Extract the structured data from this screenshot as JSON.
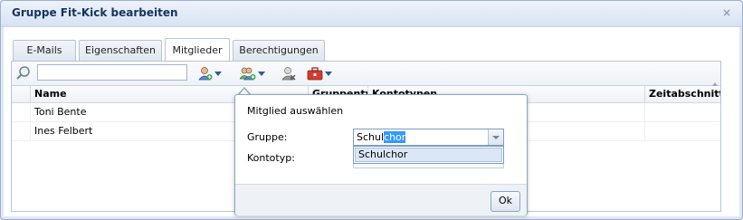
{
  "window": {
    "title": "Gruppe Fit-Kick bearbeiten",
    "close_glyph": "×"
  },
  "tabs": [
    {
      "label": "E-Mails",
      "active": false
    },
    {
      "label": "Eigenschaften",
      "active": false
    },
    {
      "label": "Mitglieder",
      "active": true
    },
    {
      "label": "Berechtigungen",
      "active": false
    }
  ],
  "toolbar": {
    "search_value": "",
    "icons": [
      "search-icon",
      "add-member-icon",
      "add-members-group-icon",
      "remove-member-icon",
      "toolbox-icon"
    ]
  },
  "grid": {
    "columns": [
      "Name",
      "Gruppentyp",
      "Kontotypen",
      "Zeitabschnitt"
    ],
    "rows": [
      {
        "name": "Toni Bente"
      },
      {
        "name": "Ines Felbert"
      }
    ]
  },
  "popup": {
    "title": "Mitglied auswählen",
    "gruppe_label": "Gruppe:",
    "kontotyp_label": "Kontotyp:",
    "combo_typed": "Schul",
    "combo_autocomplete": "chor",
    "dropdown_option": "Schulchor",
    "ok_label": "Ok"
  },
  "colors": {
    "title": "#15345c",
    "accent": "#3399ff",
    "border": "#8ea3bf"
  }
}
